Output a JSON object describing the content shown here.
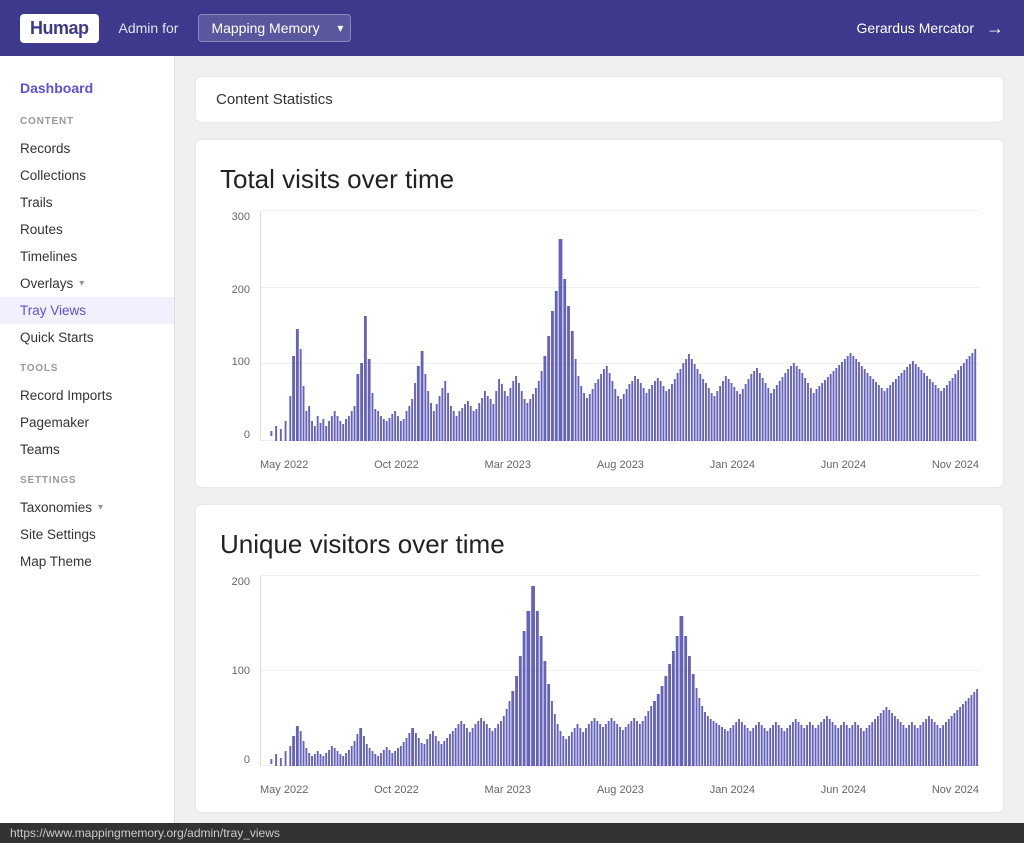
{
  "header": {
    "logo": "Humap",
    "admin_for_label": "Admin for",
    "selected_map": "Mapping Memory",
    "user_name": "Gerardus Mercator",
    "logout_icon": "→"
  },
  "sidebar": {
    "dashboard_label": "Dashboard",
    "sections": [
      {
        "label": "CONTENT",
        "items": [
          {
            "id": "records",
            "label": "Records",
            "active": false
          },
          {
            "id": "collections",
            "label": "Collections",
            "active": false
          },
          {
            "id": "trails",
            "label": "Trails",
            "active": false
          },
          {
            "id": "routes",
            "label": "Routes",
            "active": false
          },
          {
            "id": "timelines",
            "label": "Timelines",
            "active": false
          },
          {
            "id": "overlays",
            "label": "Overlays",
            "active": false,
            "has_caret": true
          },
          {
            "id": "tray-views",
            "label": "Tray Views",
            "active": true
          },
          {
            "id": "quick-starts",
            "label": "Quick Starts",
            "active": false
          }
        ]
      },
      {
        "label": "TOOLS",
        "items": [
          {
            "id": "record-imports",
            "label": "Record Imports",
            "active": false
          },
          {
            "id": "pagemaker",
            "label": "Pagemaker",
            "active": false
          },
          {
            "id": "teams",
            "label": "Teams",
            "active": false
          }
        ]
      },
      {
        "label": "SETTINGS",
        "items": [
          {
            "id": "taxonomies",
            "label": "Taxonomies",
            "active": false,
            "has_caret": true
          },
          {
            "id": "site-settings",
            "label": "Site Settings",
            "active": false
          },
          {
            "id": "map-theme",
            "label": "Map Theme",
            "active": false
          }
        ]
      }
    ]
  },
  "main": {
    "content_header": "Content Statistics",
    "chart1": {
      "title": "Total visits over time",
      "y_max": 300,
      "y_labels": [
        "300",
        "200",
        "100",
        "0"
      ],
      "x_labels": [
        "May 2022",
        "Oct 2022",
        "Mar 2023",
        "Aug 2023",
        "Jan 2024",
        "Jun 2024",
        "Nov 2024"
      ]
    },
    "chart2": {
      "title": "Unique visitors over time",
      "y_max": 200,
      "y_labels": [
        "200",
        "100",
        "0"
      ],
      "x_labels": [
        "May 2022",
        "Oct 2022",
        "Mar 2023",
        "Aug 2023",
        "Jan 2024",
        "Jun 2024",
        "Nov 2024"
      ]
    }
  },
  "status_bar": {
    "url": "https://www.mappingmemory.org/admin/tray_views"
  },
  "colors": {
    "header_bg": "#3d3a8e",
    "bar_color": "#4a47b0",
    "active_nav": "#5a52d5"
  }
}
